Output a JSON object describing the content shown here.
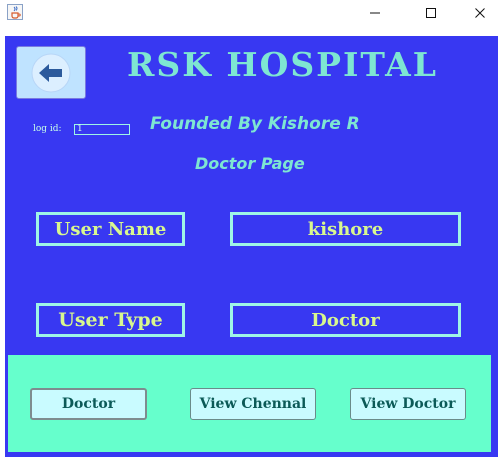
{
  "window": {
    "title": "",
    "icons": {
      "app": "java-cup-icon",
      "minimize": "minimize-icon",
      "maximize": "maximize-icon",
      "close": "close-icon"
    }
  },
  "header": {
    "hospital_name": "RSK HOSPITAL",
    "founded": "Founded By Kishore R",
    "page_title": "Doctor Page"
  },
  "log": {
    "label": "log id:",
    "value": "1"
  },
  "fields": {
    "user_name_label": "User Name",
    "user_name_value": "kishore",
    "user_type_label": "User Type",
    "user_type_value": "Doctor"
  },
  "actions": {
    "doctor": "Doctor",
    "view_chennal": "View Chennal",
    "view_doctor": "View Doctor"
  },
  "colors": {
    "main_bg": "#3838f2",
    "panel_bg": "#66ffcc",
    "title_text": "#7ee6d2",
    "field_text": "#d8f78f",
    "button_bg": "#c9fbff"
  }
}
